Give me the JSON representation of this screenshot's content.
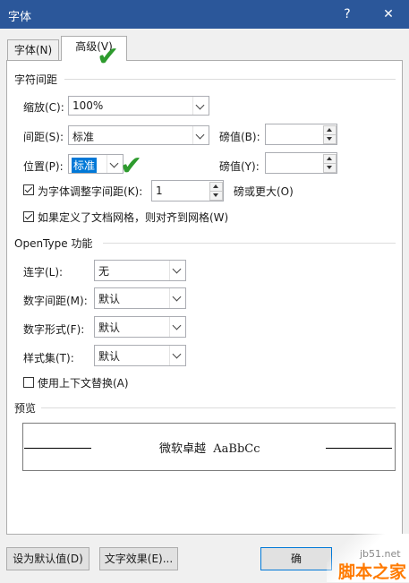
{
  "window": {
    "title": "字体",
    "help": "?",
    "close": "✕"
  },
  "tabs": [
    {
      "label": "字体(N)"
    },
    {
      "label": "高级(V)"
    }
  ],
  "spacing_group": {
    "title": "字符间距",
    "scale_label": "缩放(C):",
    "scale_value": "100%",
    "spacing_label": "间距(S):",
    "spacing_value": "标准",
    "spacing_pts_label": "磅值(B):",
    "spacing_pts_value": "",
    "position_label": "位置(P):",
    "position_value": "标准",
    "position_pts_label": "磅值(Y):",
    "position_pts_value": "",
    "kerning_label": "为字体调整字间距(K):",
    "kerning_value": "1",
    "kerning_suffix": "磅或更大(O)",
    "kerning_checked": true,
    "grid_label": "如果定义了文档网格，则对齐到网格(W)",
    "grid_checked": true
  },
  "opentype_group": {
    "title": "OpenType 功能",
    "ligatures_label": "连字(L):",
    "ligatures_value": "无",
    "num_spacing_label": "数字间距(M):",
    "num_spacing_value": "默认",
    "num_forms_label": "数字形式(F):",
    "num_forms_value": "默认",
    "stylistic_label": "样式集(T):",
    "stylistic_value": "默认",
    "contextual_label": "使用上下文替换(A)",
    "contextual_checked": false
  },
  "preview": {
    "title": "预览",
    "sample": "微软卓越  AaBbCc"
  },
  "buttons": {
    "default": "设为默认值(D)",
    "effects": "文字效果(E)...",
    "ok": "确"
  },
  "watermark": {
    "site": "脚本之家",
    "url": "jb51.net"
  },
  "colors": {
    "titlebar": "#2b579a",
    "checkmark_annotation": "#2e9b2e",
    "watermark": "#ff7a00"
  }
}
